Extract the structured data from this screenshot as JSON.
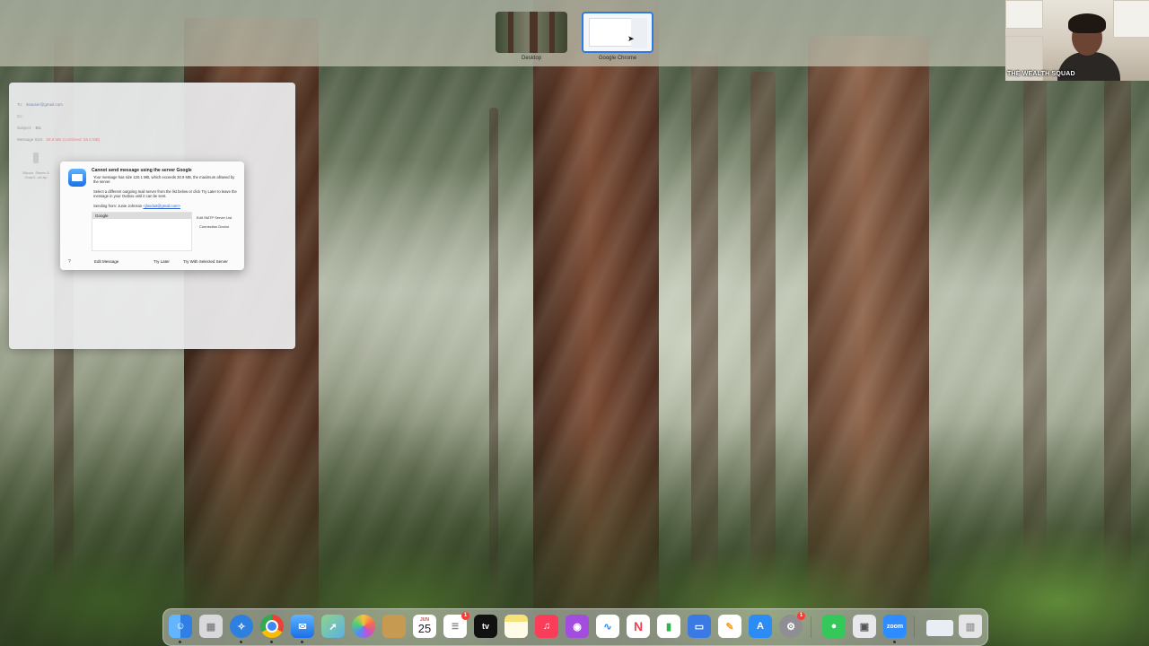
{
  "spaces": {
    "desktop_label": "Desktop",
    "chrome_label": "Google Chrome"
  },
  "webcam": {
    "label": "THE WEALTH SQUAD"
  },
  "mail": {
    "to_value": "itsauser@gmail.com",
    "cc_label": "Cc:",
    "subject_label": "Subject:",
    "subject_value": "Btc",
    "message_size_label": "Message Size:",
    "message_size_value": "58.8 MB (combined: 58.8 MB)",
    "attachment_name": "Bitcoin, Steam & Guard...ult.zip"
  },
  "alert": {
    "title": "Cannot send message using the server Google",
    "body1": "Your message has size 120.1 MB, which exceeds 30.9 MB, the maximum allowed by the server.",
    "body2": "Select a different outgoing mail server from the list below or click Try Later to leave the message in your Outbox until it can be sent.",
    "sending_from_label": "Sending from: Junie Johnson",
    "sending_from_email": "<jlooduit@gmail.com>",
    "servers": [
      "Google"
    ],
    "edit_smtp": "Edit SMTP Server List",
    "connection_doctor": "Connection Doctor",
    "help": "?",
    "edit_message": "Edit Message",
    "try_later": "Try Later",
    "try_selected": "Try With Selected Server"
  },
  "dock": {
    "calendar_month": "JUN",
    "calendar_day": "25",
    "reminders_badge": "1",
    "settings_badge": "1",
    "tv_label": "tv",
    "zoom_label": "zoom",
    "items": [
      {
        "name": "finder-icon",
        "color": "#3a8ff0"
      },
      {
        "name": "launchpad-icon",
        "color": "#d9d9dd"
      },
      {
        "name": "safari-icon",
        "color": "#2d7fe0"
      },
      {
        "name": "chrome-icon",
        "color": "#f2f2f2"
      },
      {
        "name": "mail-icon",
        "color": "#3b8ef3"
      },
      {
        "name": "maps-icon",
        "color": "#6cc46a"
      },
      {
        "name": "photos-icon",
        "color": "#f5f5f5"
      },
      {
        "name": "notes-app-icon",
        "color": "#c79a52"
      },
      {
        "name": "calendar-icon",
        "color": "#ffffff"
      },
      {
        "name": "reminders-icon",
        "color": "#ffffff"
      },
      {
        "name": "appletv-icon",
        "color": "#111111"
      },
      {
        "name": "notes-icon",
        "color": "#f7e27a"
      },
      {
        "name": "music-icon",
        "color": "#fa3e5a"
      },
      {
        "name": "podcasts-icon",
        "color": "#a24ce0"
      },
      {
        "name": "freeform-icon",
        "color": "#ffffff"
      },
      {
        "name": "news-icon",
        "color": "#f13f4f"
      },
      {
        "name": "numbers-icon",
        "color": "#2fb34a"
      },
      {
        "name": "keynote-icon",
        "color": "#3b7ae5"
      },
      {
        "name": "pages-icon",
        "color": "#f4a12a"
      },
      {
        "name": "appstore-icon",
        "color": "#2a8cf4"
      },
      {
        "name": "system-settings-icon",
        "color": "#8e8e93"
      },
      {
        "name": "messages-icon",
        "color": "#34c759"
      },
      {
        "name": "preview-icon",
        "color": "#e8e8ec"
      },
      {
        "name": "zoom-icon",
        "color": "#2d8cff"
      },
      {
        "name": "finder-window-icon",
        "color": "#e9eef5"
      },
      {
        "name": "trash-icon",
        "color": "#e5e5e7"
      }
    ]
  }
}
